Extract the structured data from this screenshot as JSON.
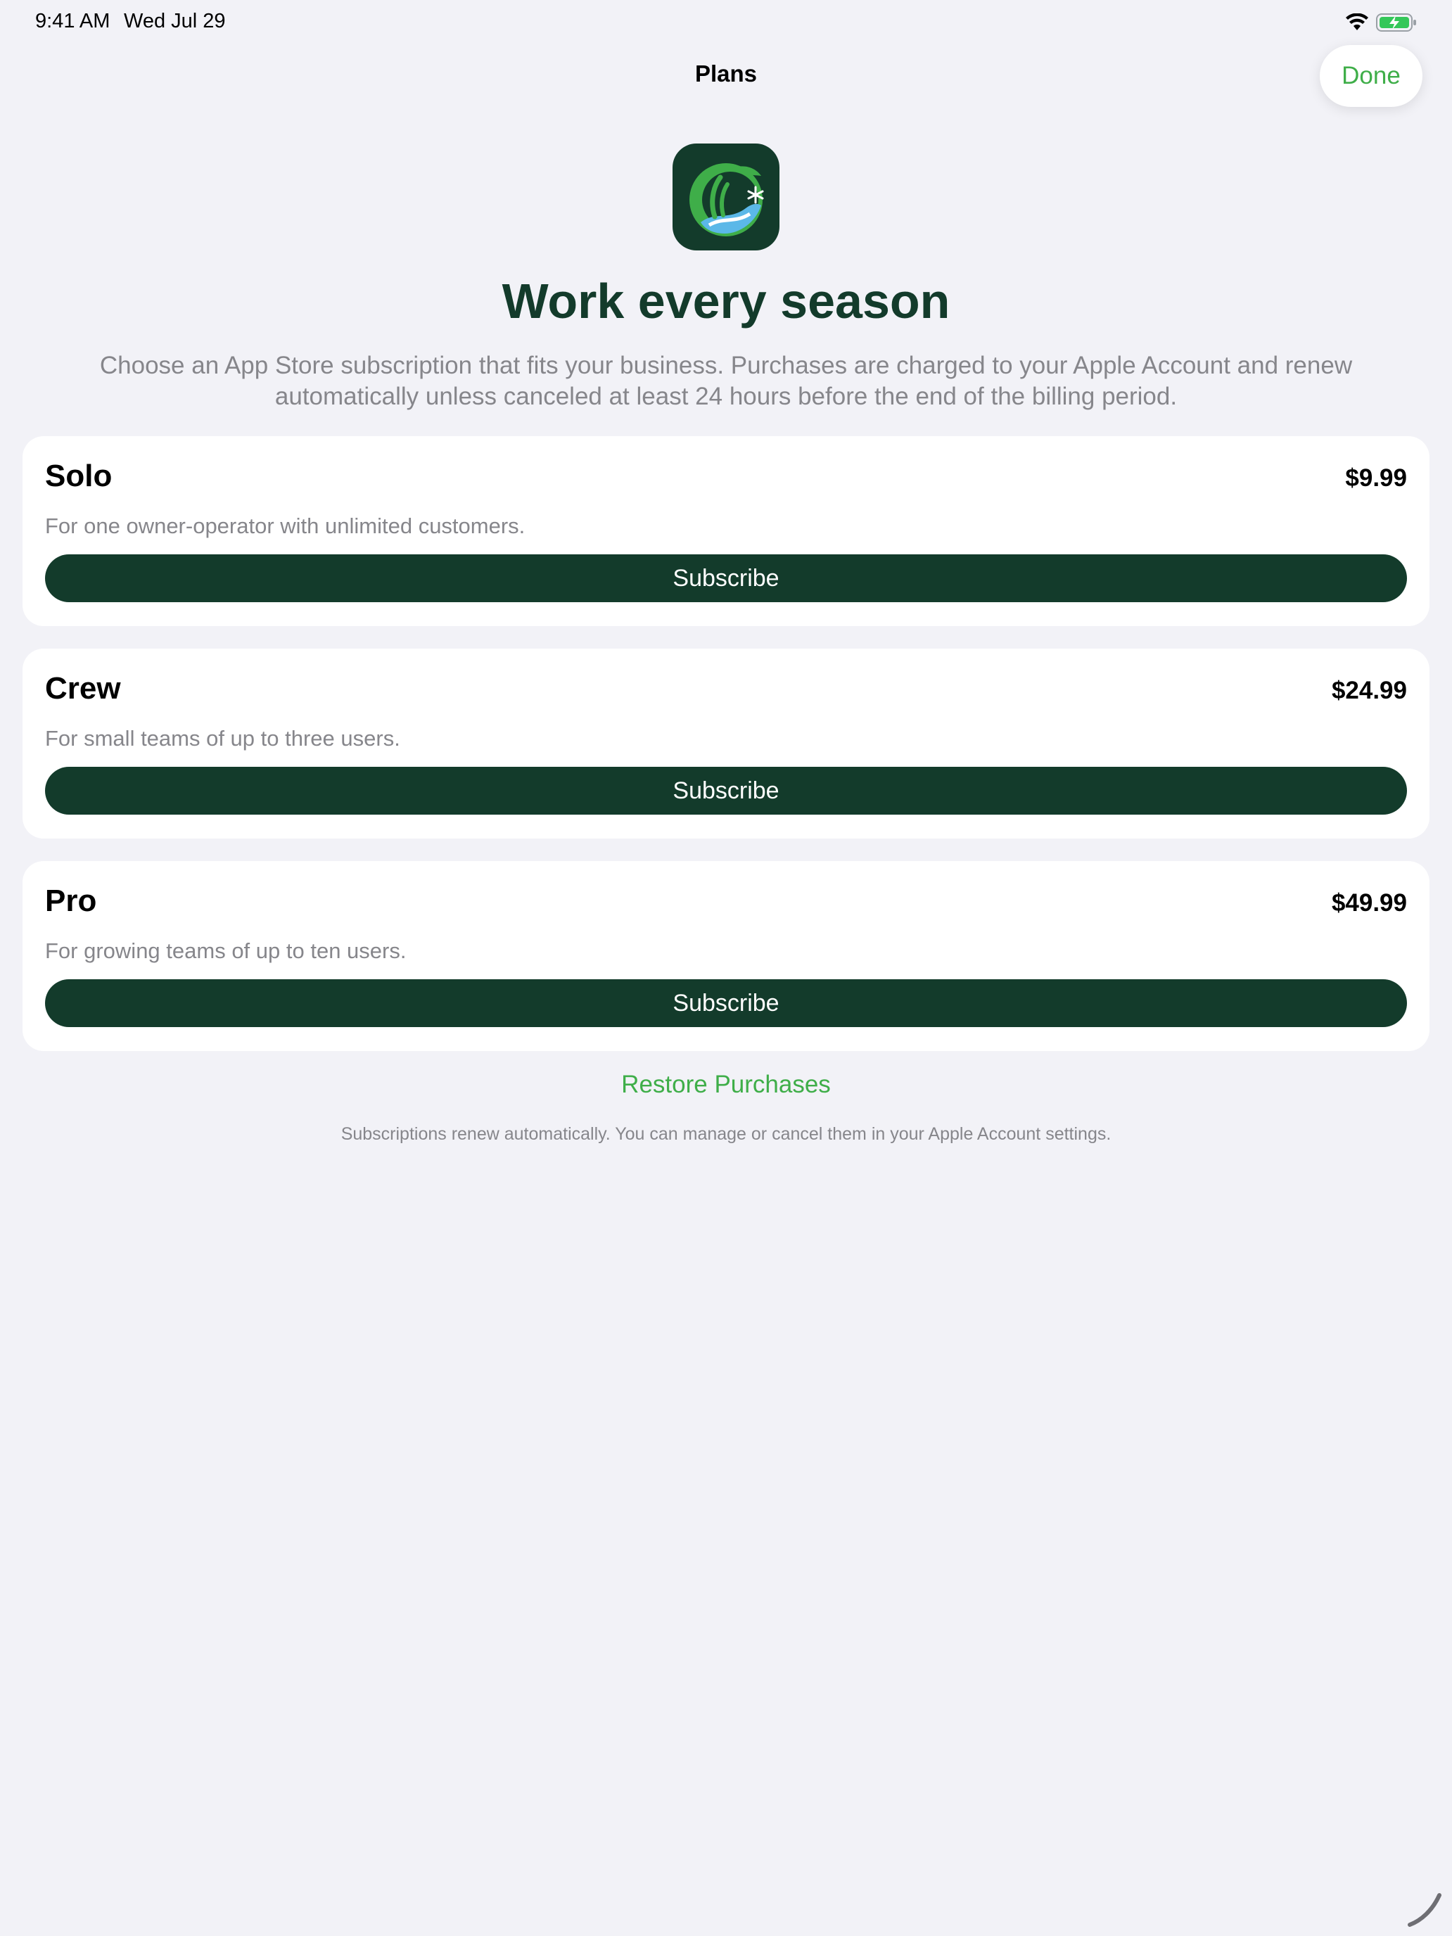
{
  "status_bar": {
    "time": "9:41 AM",
    "date": "Wed Jul 29",
    "icons": [
      "wifi-icon",
      "battery-charging-icon"
    ]
  },
  "nav": {
    "title": "Plans",
    "done_label": "Done"
  },
  "hero": {
    "headline": "Work every season",
    "intro": "Choose an App Store subscription that fits your business. Purchases are charged to your Apple Account and renew automatically unless canceled at least 24 hours before the end of the billing period."
  },
  "plans": [
    {
      "name": "Solo",
      "price": "$9.99",
      "description": "For one owner-operator with unlimited customers.",
      "button_label": "Subscribe"
    },
    {
      "name": "Crew",
      "price": "$24.99",
      "description": "For small teams of up to three users.",
      "button_label": "Subscribe"
    },
    {
      "name": "Pro",
      "price": "$49.99",
      "description": "For growing teams of up to ten users.",
      "button_label": "Subscribe"
    }
  ],
  "footer": {
    "restore_label": "Restore Purchases",
    "note": "Subscriptions renew automatically. You can manage or cancel them in your Apple Account settings."
  },
  "colors": {
    "background": "#f2f2f7",
    "brand_dark_green": "#133b2b",
    "accent_green": "#3fae49",
    "secondary_text": "#86868b"
  }
}
